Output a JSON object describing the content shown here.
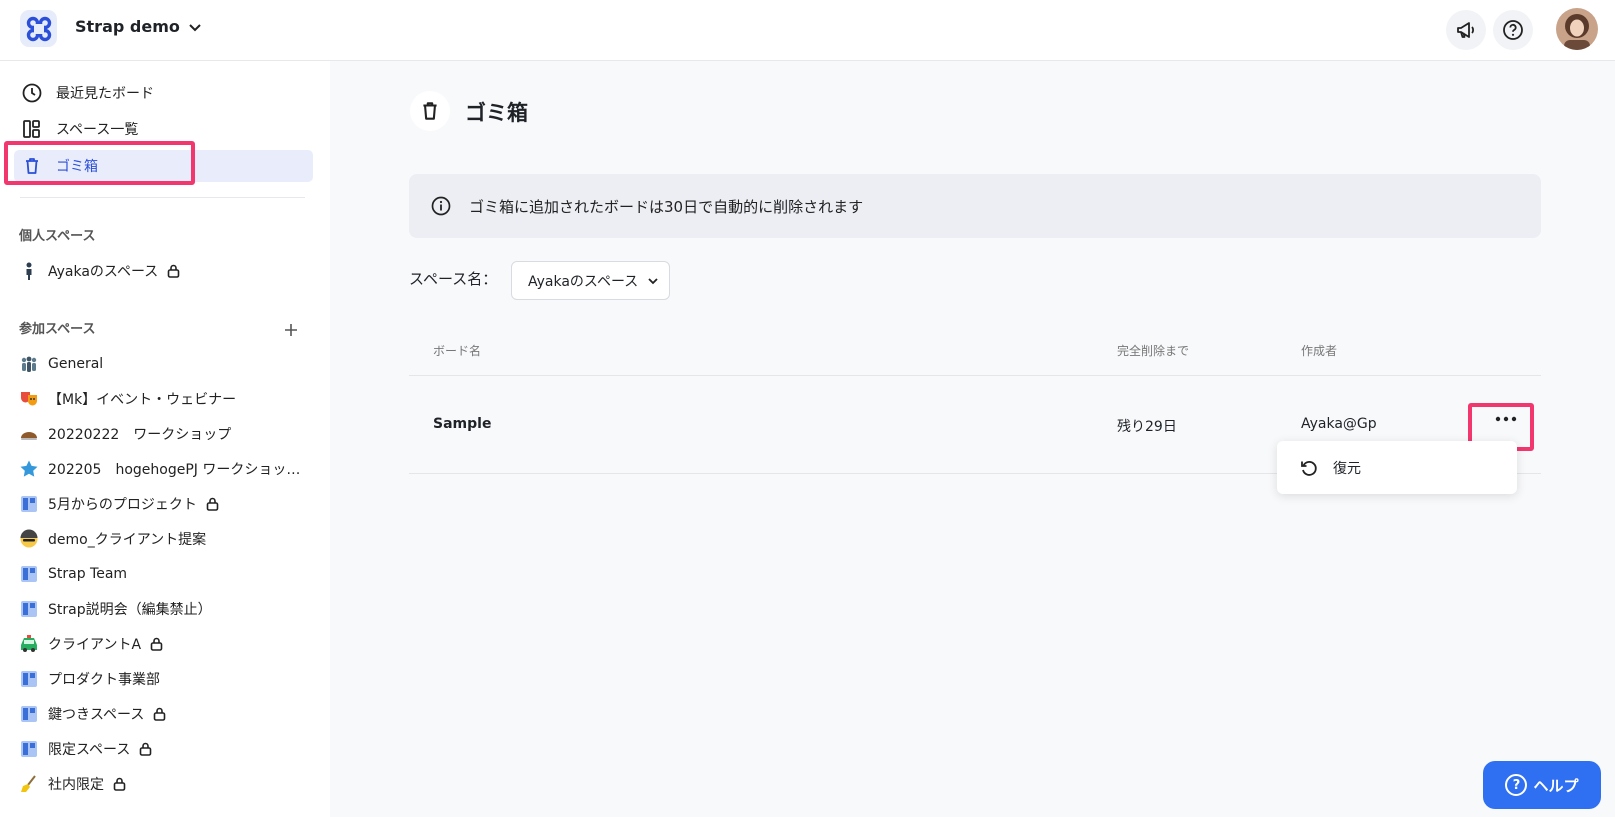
{
  "header": {
    "workspace_name": "Strap demo"
  },
  "sidebar": {
    "nav": [
      {
        "label": "最近見たボード"
      },
      {
        "label": "スペース一覧"
      },
      {
        "label": "ゴミ箱"
      }
    ],
    "personal_section": "個人スペース",
    "personal_spaces": [
      {
        "label": "Ayakaのスペース"
      }
    ],
    "joined_section": "参加スペース",
    "joined_spaces": [
      {
        "label": "General"
      },
      {
        "label": "【Mk】イベント・ウェビナー"
      },
      {
        "label": "20220222　ワークショップ"
      },
      {
        "label": "202205　hogehogePJ ワークショップ…"
      },
      {
        "label": "5月からのプロジェクト"
      },
      {
        "label": "demo_クライアント提案"
      },
      {
        "label": "Strap Team"
      },
      {
        "label": "Strap説明会（編集禁止）"
      },
      {
        "label": "クライアントA"
      },
      {
        "label": "プロダクト事業部"
      },
      {
        "label": "鍵つきスペース"
      },
      {
        "label": "限定スペース"
      },
      {
        "label": "社内限定"
      }
    ]
  },
  "main": {
    "title": "ゴミ箱",
    "info_text": "ゴミ箱に追加されたボードは30日で自動的に削除されます",
    "space_filter_label": "スペース名：",
    "space_filter_value": "Ayakaのスペース",
    "table": {
      "headers": [
        "ボード名",
        "完全削除まで",
        "作成者"
      ],
      "rows": [
        {
          "name": "Sample",
          "remaining": "残り29日",
          "author": "Ayaka@Gp"
        }
      ]
    },
    "menu": {
      "restore_label": "復元"
    }
  },
  "help": {
    "label": "ヘルプ"
  }
}
